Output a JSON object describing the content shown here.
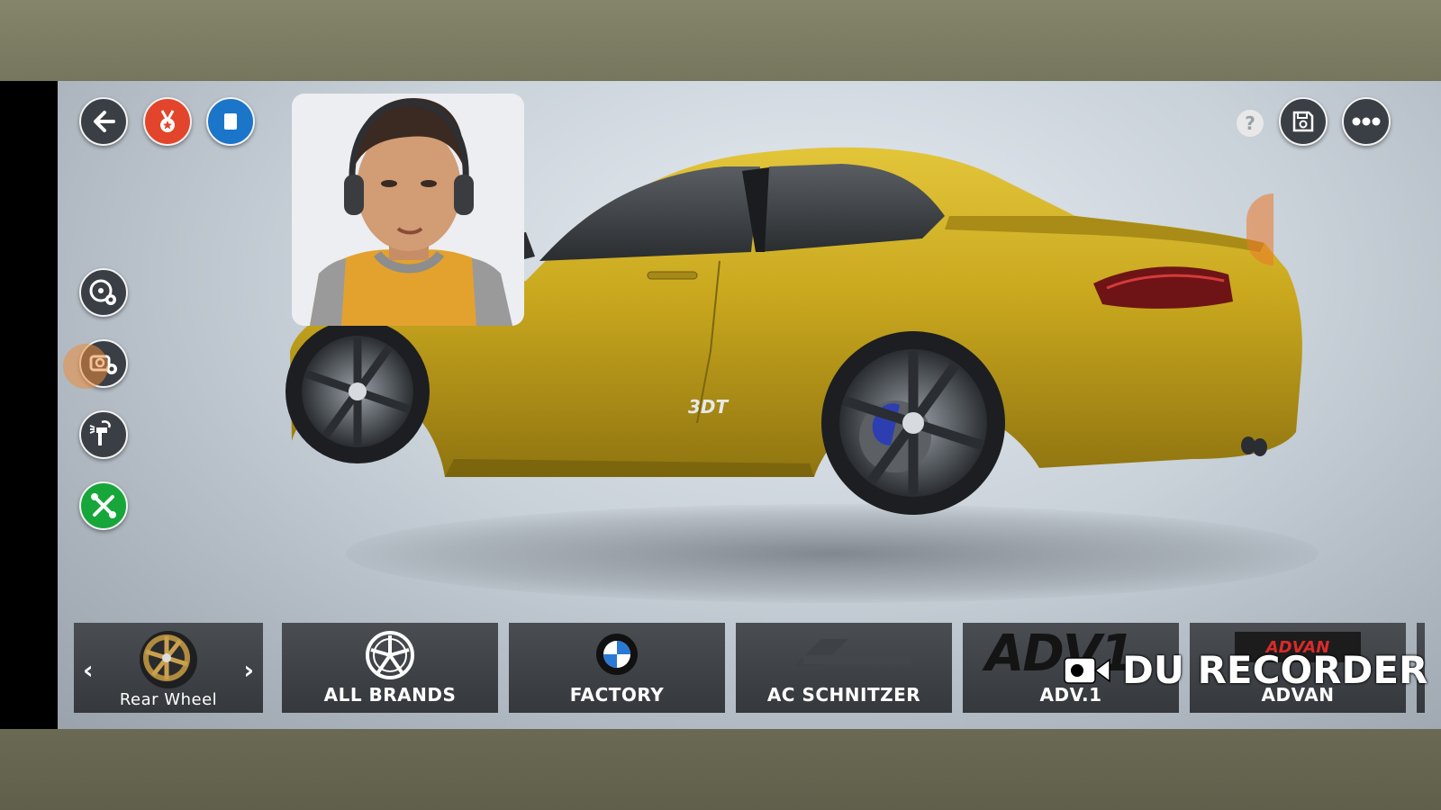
{
  "overlay": {
    "watermark_text": "DU RECORDER"
  },
  "top_right": {
    "help_label": "?"
  },
  "car": {
    "badge_text": "3DT",
    "body_color": "#c9a81e"
  },
  "wheel_selector": {
    "label": "Rear Wheel",
    "prev_arrow": "‹",
    "next_arrow": "›"
  },
  "brands": [
    {
      "label": "ALL BRANDS"
    },
    {
      "label": "FACTORY"
    },
    {
      "label": "AC SCHNITZER"
    },
    {
      "label": "ADV.1",
      "logo_text": "ADV1"
    },
    {
      "label": "ADVAN",
      "logo_text": "ADVAN"
    }
  ],
  "colors": {
    "back_button": "#3a3f45",
    "achievement_button": "#e2452b",
    "tuning_button": "#17a63a",
    "info_button": "#1b75c9"
  }
}
